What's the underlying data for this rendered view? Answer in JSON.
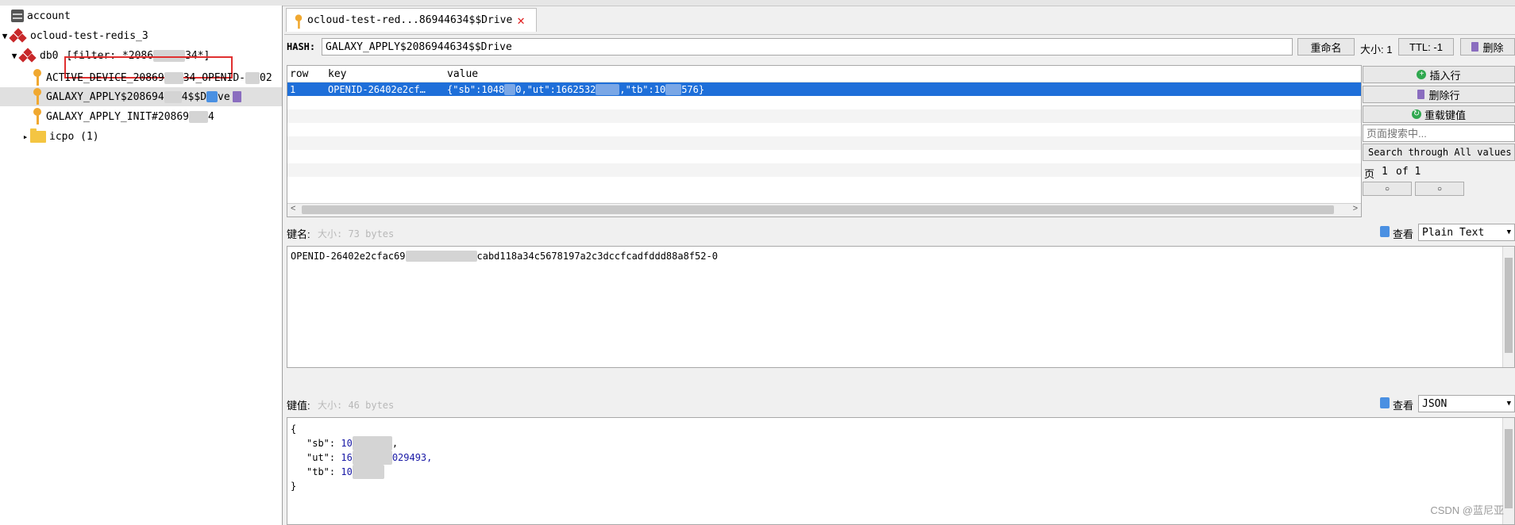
{
  "tree": {
    "account_label": "account",
    "server_label": "ocloud-test-redis_3",
    "db_label": "db0",
    "filter_label": "[filter: *2086",
    "filter_tail": "34*]",
    "keys": [
      {
        "label": "ACTIVE_DEVICE_20869",
        "tail": "34_OPENID-",
        "end": "02"
      },
      {
        "label": "GALAXY_APPLY$208694",
        "tail": "4$$D",
        "end": "ve"
      },
      {
        "label": "GALAXY_APPLY_INIT#20869",
        "tail": "4",
        "end": ""
      }
    ],
    "folder_label": "icpo (1)"
  },
  "tab": {
    "title": "ocloud-test-red...86944634$$Drive",
    "close_icon": "close-icon"
  },
  "toolbar": {
    "hash_label": "HASH:",
    "key_name": "GALAXY_APPLY$2086944634$$Drive",
    "rename_label": "重命名",
    "size_label": "大小: 1",
    "ttl_label": "TTL: -1",
    "delete_label": "删除"
  },
  "table": {
    "columns": [
      "row",
      "key",
      "value"
    ],
    "rows": [
      {
        "row": "1",
        "key": "OPENID-26402e2cf…",
        "value_a": "{\"sb\":1048",
        "value_b": "0,\"ut\":1662532",
        "value_c": ",\"tb\":10",
        "value_d": "576}"
      }
    ]
  },
  "side": {
    "insert_label": "插入行",
    "delete_row_label": "删除行",
    "reload_label": "重载键值",
    "search_placeholder": "页面搜索中...",
    "search_all_label": "Search through All values",
    "page_label": "页",
    "page_num": "1",
    "page_of": "of 1",
    "prev": "○",
    "next": "○"
  },
  "keypanel": {
    "label": "键名:",
    "size": "大小: 73 bytes",
    "view_label": "查看",
    "format": "Plain Text",
    "text_a": "OPENID-26402e2cfac69",
    "text_b": "cabd118a34c5678197a2c3dccfcadfddd88a8f52-0"
  },
  "valpanel": {
    "label": "键值:",
    "size": "大小: 46 bytes",
    "view_label": "查看",
    "format": "JSON",
    "open": "{",
    "close": "}",
    "sb_key": "\"sb\": ",
    "sb_val": "10",
    "ut_key": "\"ut\": ",
    "ut_val_a": "16",
    "ut_val_b": "029493,",
    "tb_key": "\"tb\": ",
    "tb_val": "10"
  },
  "watermark": "CSDN @蓝尼亚"
}
